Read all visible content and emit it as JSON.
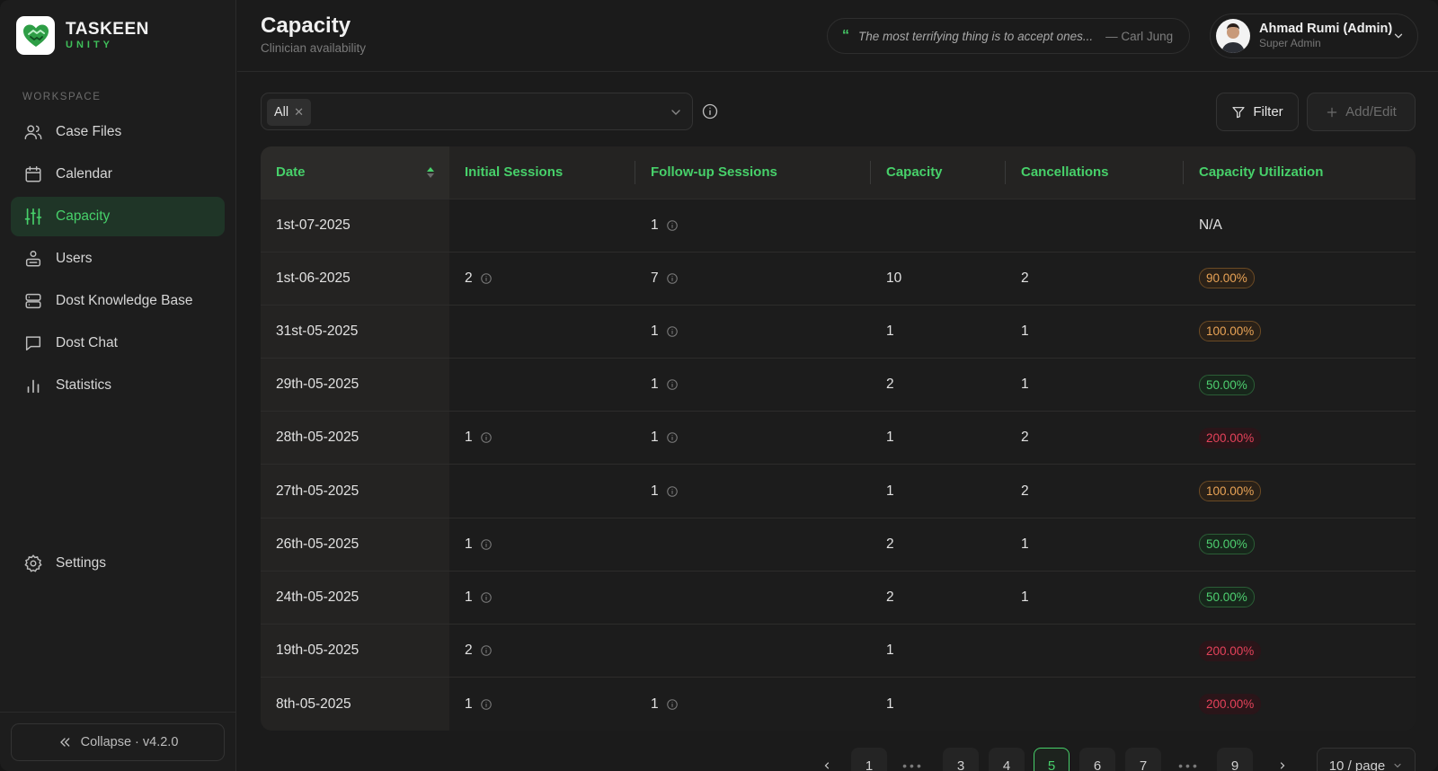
{
  "brand": {
    "name": "TASKEEN",
    "sub": "UNITY"
  },
  "sidebar": {
    "section_label": "WORKSPACE",
    "items": [
      {
        "label": "Case Files",
        "icon": "users-icon"
      },
      {
        "label": "Calendar",
        "icon": "calendar-icon"
      },
      {
        "label": "Capacity",
        "icon": "sliders-icon",
        "active": true
      },
      {
        "label": "Users",
        "icon": "user-cog-icon"
      },
      {
        "label": "Dost Knowledge Base",
        "icon": "database-icon"
      },
      {
        "label": "Dost Chat",
        "icon": "chat-icon"
      },
      {
        "label": "Statistics",
        "icon": "bar-chart-icon"
      }
    ],
    "settings_label": "Settings",
    "collapse_label": "Collapse · v4.2.0"
  },
  "header": {
    "title": "Capacity",
    "subtitle": "Clinician availability",
    "quote_text": "The most terrifying thing is to accept ones...",
    "quote_author": "— Carl Jung",
    "user_name": "Ahmad Rumi (Admin)",
    "user_role": "Super Admin"
  },
  "toolbar": {
    "select_tag": "All",
    "filter_label": "Filter",
    "add_label": "Add/Edit"
  },
  "table": {
    "columns": [
      "Date",
      "Initial Sessions",
      "Follow-up Sessions",
      "Capacity",
      "Cancellations",
      "Capacity Utilization"
    ],
    "rows": [
      {
        "date": "1st-07-2025",
        "initial": "",
        "followup": "1",
        "capacity": "",
        "cancellations": "",
        "utilization": "N/A",
        "status": "none"
      },
      {
        "date": "1st-06-2025",
        "initial": "2",
        "followup": "7",
        "capacity": "10",
        "cancellations": "2",
        "utilization": "90.00%",
        "status": "orange"
      },
      {
        "date": "31st-05-2025",
        "initial": "",
        "followup": "1",
        "capacity": "1",
        "cancellations": "1",
        "utilization": "100.00%",
        "status": "orange"
      },
      {
        "date": "29th-05-2025",
        "initial": "",
        "followup": "1",
        "capacity": "2",
        "cancellations": "1",
        "utilization": "50.00%",
        "status": "green"
      },
      {
        "date": "28th-05-2025",
        "initial": "1",
        "followup": "1",
        "capacity": "1",
        "cancellations": "2",
        "utilization": "200.00%",
        "status": "red"
      },
      {
        "date": "27th-05-2025",
        "initial": "",
        "followup": "1",
        "capacity": "1",
        "cancellations": "2",
        "utilization": "100.00%",
        "status": "orange"
      },
      {
        "date": "26th-05-2025",
        "initial": "1",
        "followup": "",
        "capacity": "2",
        "cancellations": "1",
        "utilization": "50.00%",
        "status": "green"
      },
      {
        "date": "24th-05-2025",
        "initial": "1",
        "followup": "",
        "capacity": "2",
        "cancellations": "1",
        "utilization": "50.00%",
        "status": "green"
      },
      {
        "date": "19th-05-2025",
        "initial": "2",
        "followup": "",
        "capacity": "1",
        "cancellations": "",
        "utilization": "200.00%",
        "status": "red"
      },
      {
        "date": "8th-05-2025",
        "initial": "1",
        "followup": "1",
        "capacity": "1",
        "cancellations": "",
        "utilization": "200.00%",
        "status": "red"
      }
    ]
  },
  "pagination": {
    "pages": [
      "1",
      "3",
      "4",
      "5",
      "6",
      "7",
      "9"
    ],
    "current": "5",
    "page_size": "10 / page"
  },
  "colors": {
    "accent": "#47d06a",
    "orange": "#e9a356",
    "red": "#e4425a"
  }
}
